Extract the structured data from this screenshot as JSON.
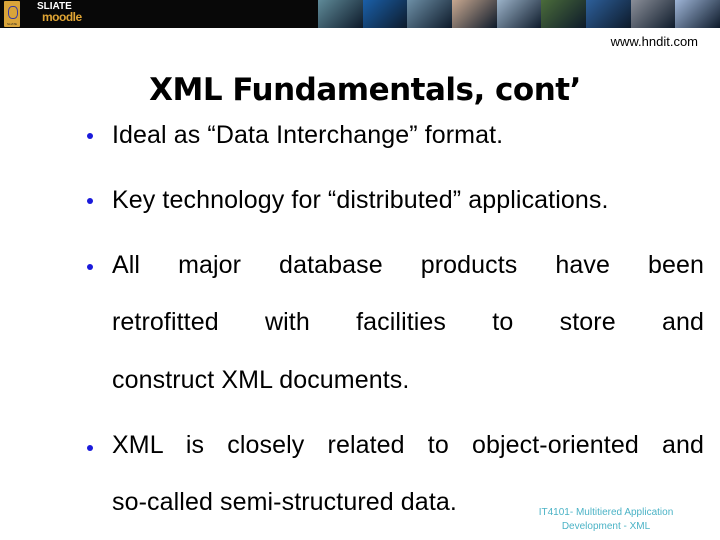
{
  "banner": {
    "badge_text": "SLIATE",
    "brand_top": "SLIATE",
    "brand_bottom": "moodle",
    "photos": [
      {
        "name": "robot-photo",
        "color": "#5f8a98"
      },
      {
        "name": "globe-eye-photo",
        "color": "#1a5fa8"
      },
      {
        "name": "touchscreen-hand-photo",
        "color": "#6d8fa6"
      },
      {
        "name": "students-laptop-photo",
        "color": "#c8a890"
      },
      {
        "name": "keyboard-photo",
        "color": "#9bb2c8"
      },
      {
        "name": "classroom-photo",
        "color": "#4a6b3a"
      },
      {
        "name": "earth-photo",
        "color": "#2d5f9a"
      },
      {
        "name": "cyber-face-photo",
        "color": "#8a8e98"
      },
      {
        "name": "eye-closeup-photo",
        "color": "#9eb4d6"
      }
    ]
  },
  "header": {
    "url": "www.hndit.com"
  },
  "slide": {
    "title": "XML Fundamentals, cont’",
    "bullets": [
      {
        "lines": [
          "Ideal as “Data Interchange” format."
        ]
      },
      {
        "lines": [
          "Key technology for “distributed” applications."
        ]
      },
      {
        "lines": [
          "All major database products have been",
          "retrofitted with facilities to store and",
          "construct XML documents."
        ]
      },
      {
        "lines": [
          "XML is closely related to object-oriented and",
          "so-called semi-structured data."
        ]
      }
    ],
    "bullet_color": "#1a1adb"
  },
  "footer": {
    "line1": "IT4101- Multitiered Application",
    "line2": "Development - XML",
    "color": "#4bb3c6"
  }
}
